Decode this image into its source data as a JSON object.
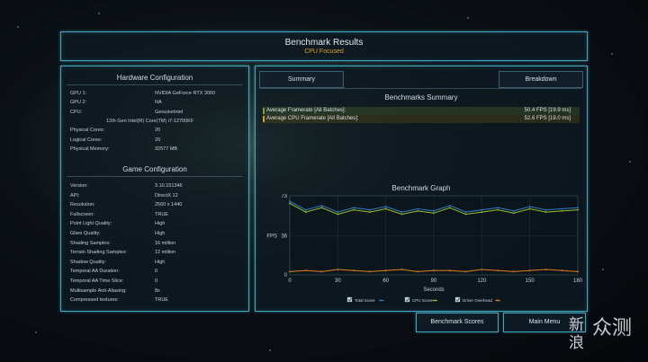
{
  "header": {
    "title": "Benchmark Results",
    "subtitle": "CPU Focused"
  },
  "hardware": {
    "title": "Hardware Configuration",
    "rows": [
      {
        "key": "GPU 1:",
        "value": "NVIDIA GeForce RTX 3060"
      },
      {
        "key": "GPU 2:",
        "value": "NA"
      },
      {
        "key": "CPU:",
        "value": "GenuineIntel"
      },
      {
        "key": "",
        "value": "12th Gen Intel(R) Core(TM) i7-12700KF"
      },
      {
        "key": "Physical Cores:",
        "value": "20"
      },
      {
        "key": "Logical Cores:",
        "value": "20"
      },
      {
        "key": "Physical Memory:",
        "value": "32577 MB"
      }
    ]
  },
  "game": {
    "title": "Game Configuration",
    "rows": [
      {
        "key": "Version:",
        "value": "3.10.151346"
      },
      {
        "key": "API:",
        "value": "DirectX 12"
      },
      {
        "key": "Resolution:",
        "value": "2560 x 1440"
      },
      {
        "key": "Fullscreen:",
        "value": "TRUE"
      },
      {
        "key": "Point Light Quality:",
        "value": "High"
      },
      {
        "key": "Glare Quality:",
        "value": "High"
      },
      {
        "key": "Shading Samples:",
        "value": "16 million"
      },
      {
        "key": "Terrain Shading Samples:",
        "value": "12 million"
      },
      {
        "key": "Shadow Quality:",
        "value": "High"
      },
      {
        "key": "Temporal AA Duration:",
        "value": "0"
      },
      {
        "key": "Temporal AA Time Slice:",
        "value": "0"
      },
      {
        "key": "Multisample Anti-Aliasing:",
        "value": "8x"
      },
      {
        "key": "Compressed textures:",
        "value": "TRUE"
      }
    ]
  },
  "tabs": {
    "summary": "Summary",
    "breakdown": "Breakdown"
  },
  "summary": {
    "title": "Benchmarks Summary",
    "rows": [
      {
        "label": "Average Framerate [All Batches]:",
        "value": "50.4 FPS [19.9 ms]",
        "color": "#7fa030"
      },
      {
        "label": "Average CPU Framerate [All Batches]:",
        "value": "52.6 FPS [19.0 ms]",
        "color": "#d0a020"
      }
    ]
  },
  "graph": {
    "title": "Benchmark Graph"
  },
  "chart_data": {
    "type": "line",
    "title": "Benchmark Graph",
    "xlabel": "Seconds",
    "ylabel": "FPS",
    "xlim": [
      0,
      180
    ],
    "ylim": [
      0,
      73
    ],
    "xticks": [
      "0",
      "30",
      "60",
      "90",
      "120",
      "150",
      "180"
    ],
    "yticks": [
      "0",
      "36",
      "73"
    ],
    "x": [
      0,
      10,
      20,
      30,
      40,
      50,
      60,
      70,
      80,
      90,
      100,
      110,
      120,
      130,
      140,
      150,
      160,
      170,
      180
    ],
    "series": [
      {
        "name": "Total Score",
        "color": "#2e7fc4",
        "values": [
          68,
          60,
          64,
          58,
          62,
          60,
          63,
          58,
          61,
          59,
          64,
          58,
          60,
          62,
          59,
          63,
          60,
          61,
          62
        ]
      },
      {
        "name": "CPU Score",
        "color": "#9bbf2a",
        "values": [
          66,
          58,
          62,
          56,
          60,
          58,
          61,
          56,
          59,
          57,
          62,
          56,
          58,
          60,
          57,
          61,
          58,
          59,
          60
        ]
      },
      {
        "name": "Driver Overhead",
        "color": "#e0801c",
        "values": [
          3,
          4,
          3,
          5,
          4,
          3,
          4,
          5,
          3,
          4,
          4,
          3,
          5,
          4,
          3,
          4,
          5,
          4,
          3
        ]
      }
    ],
    "legend": "bottom"
  },
  "buttons": {
    "scores": "Benchmark Scores",
    "menu": "Main Menu"
  },
  "watermark": {
    "text1": "新",
    "text2": "浪",
    "text3": "众测"
  }
}
